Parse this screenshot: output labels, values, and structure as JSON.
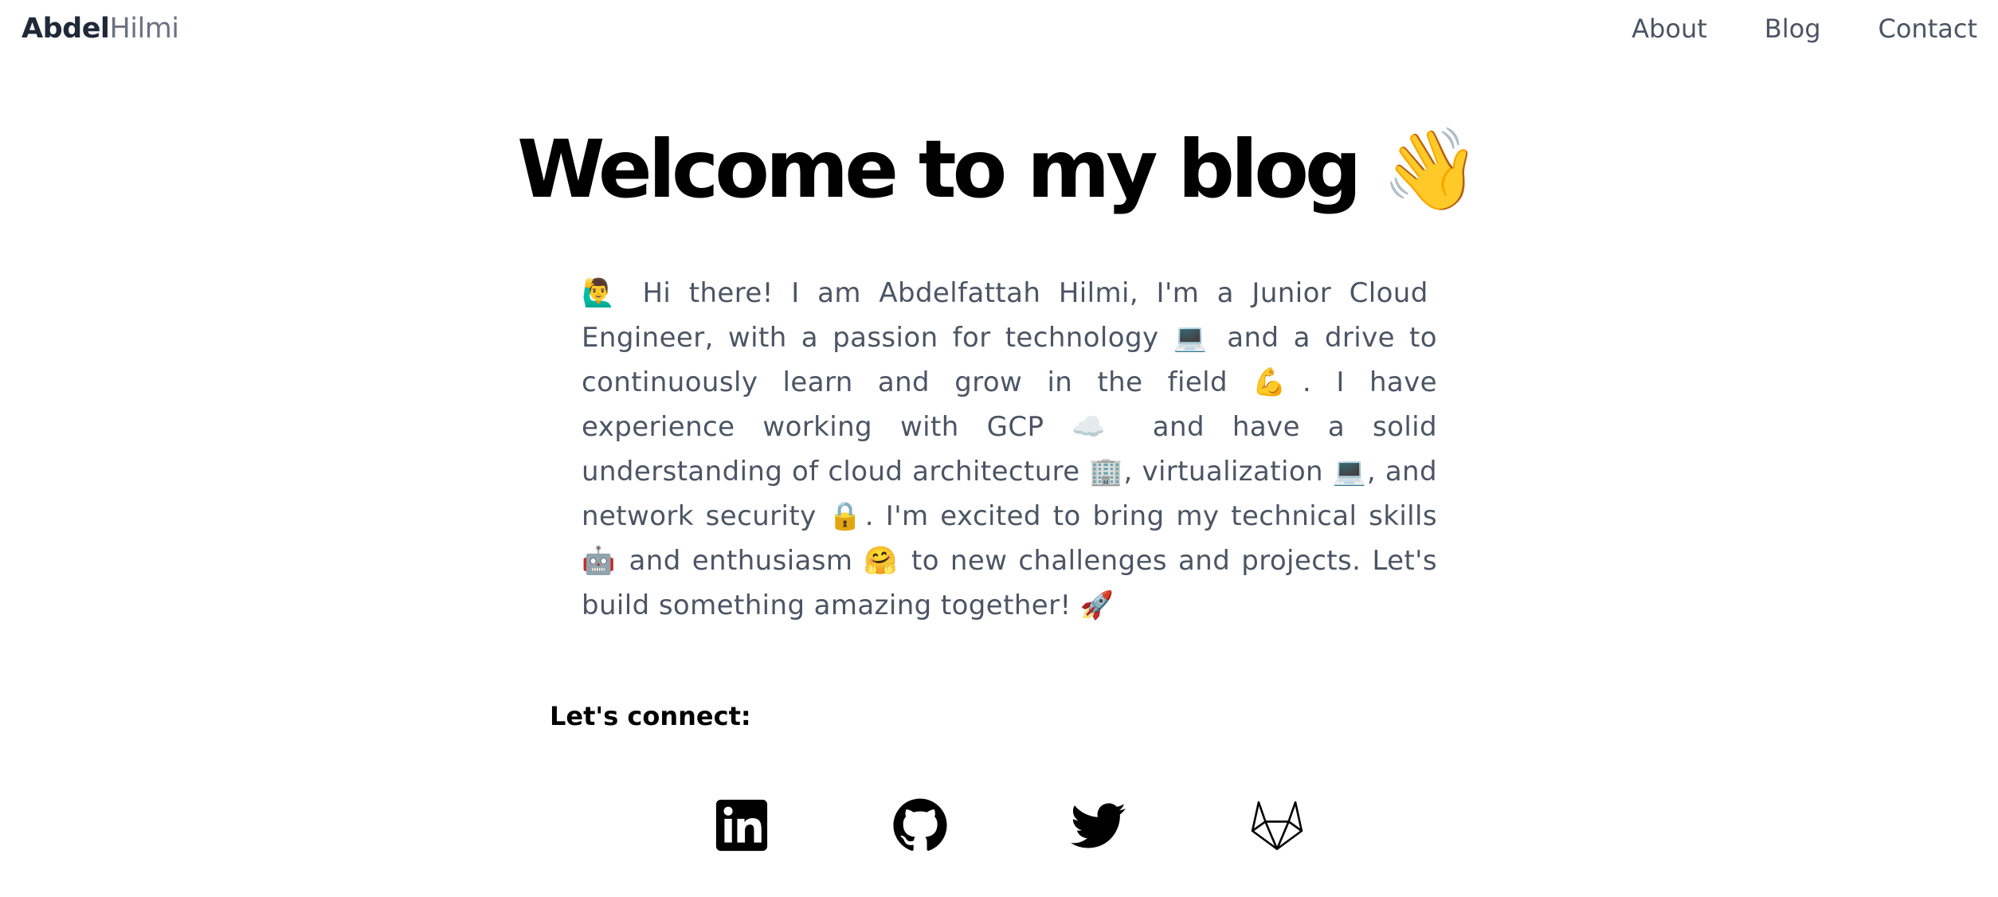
{
  "header": {
    "brand_first": "Abdel",
    "brand_last": "Hilmi",
    "nav": [
      {
        "label": "About"
      },
      {
        "label": "Blog"
      },
      {
        "label": "Contact"
      }
    ]
  },
  "hero": {
    "title": "Welcome to my blog",
    "title_emoji": "👋",
    "intro": "🙋‍♂️  Hi there! I am Abdelfattah Hilmi, I'm a Junior Cloud  Engineer, with a passion for technology 💻  and a drive to continuously learn and grow in the field 💪. I have experience working with GCP ☁️ and have a solid understanding of cloud architecture 🏢, virtualization 💻, and network security 🔒. I'm excited to bring my technical skills 🤖 and enthusiasm 🤗 to new challenges and projects. Let's build something amazing together! 🚀"
  },
  "connect": {
    "heading": "Let's connect:",
    "links": [
      {
        "icon": "linkedin-icon"
      },
      {
        "icon": "github-icon"
      },
      {
        "icon": "twitter-icon"
      },
      {
        "icon": "gitlab-icon"
      }
    ]
  },
  "colors": {
    "text_dark": "#000000",
    "text_muted": "#4b5563",
    "brand_muted": "#6b7280",
    "background": "#ffffff"
  }
}
